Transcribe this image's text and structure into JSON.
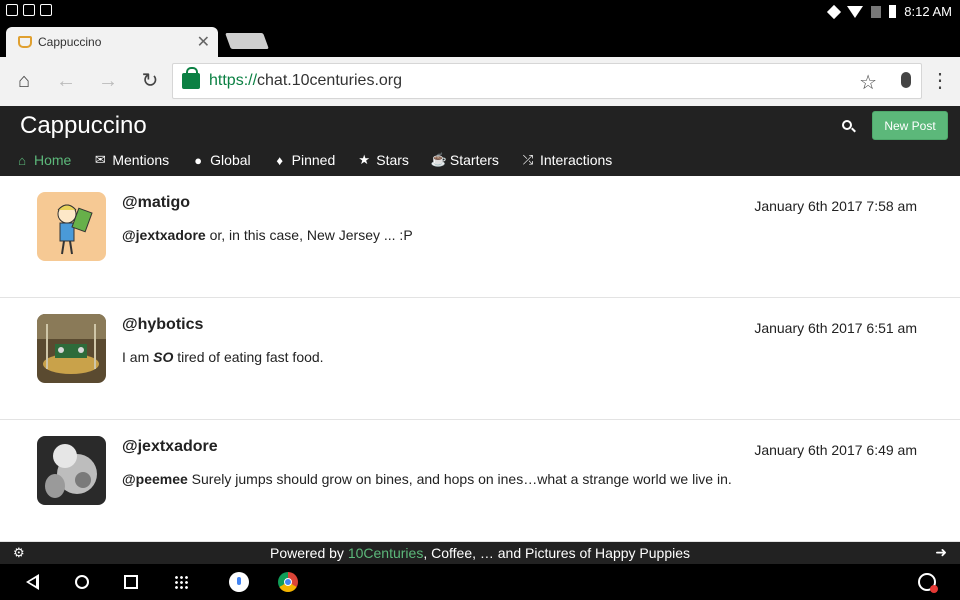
{
  "status_bar": {
    "time": "8:12 AM"
  },
  "browser": {
    "tab_title": "Cappuccino",
    "url_scheme": "https://",
    "url_host": "chat.10centuries.org"
  },
  "app": {
    "brand": "Cappuccino",
    "new_post_label": "New Post",
    "nav": [
      {
        "label": "Home",
        "icon": "home-icon",
        "active": true
      },
      {
        "label": "Mentions",
        "icon": "chat-bubbles-icon",
        "active": false
      },
      {
        "label": "Global",
        "icon": "globe-icon",
        "active": false
      },
      {
        "label": "Pinned",
        "icon": "pin-icon",
        "active": false
      },
      {
        "label": "Stars",
        "icon": "star-icon",
        "active": false
      },
      {
        "label": "Starters",
        "icon": "coffee-cup-icon",
        "active": false
      },
      {
        "label": "Interactions",
        "icon": "shuffle-icon",
        "active": false
      }
    ]
  },
  "posts": [
    {
      "username": "@matigo",
      "timestamp": "January 6th 2017 7:58 am",
      "mention": "@jextxadore",
      "text": " or, in this case, New Jersey ... :P",
      "avatar": "cartoon-avatar"
    },
    {
      "username": "@hybotics",
      "timestamp": "January 6th 2017 6:51 am",
      "text_before": "I am ",
      "emphasis": "SO",
      "text_after": " tired of eating fast food.",
      "avatar": "robot-photo-avatar"
    },
    {
      "username": "@jextxadore",
      "timestamp": "January 6th 2017 6:49 am",
      "mention": "@peemee",
      "text": " Surely jumps should grow on bines, and hops on ines…what a strange world we live in.",
      "avatar": "bw-photo-avatar"
    }
  ],
  "footer": {
    "prefix": "Powered by ",
    "link": "10Centuries",
    "suffix": ", Coffee, … and Pictures of Happy Puppies"
  },
  "colors": {
    "accent": "#5cb87a",
    "header_bg": "#222222",
    "secure_green": "#0b8043"
  }
}
